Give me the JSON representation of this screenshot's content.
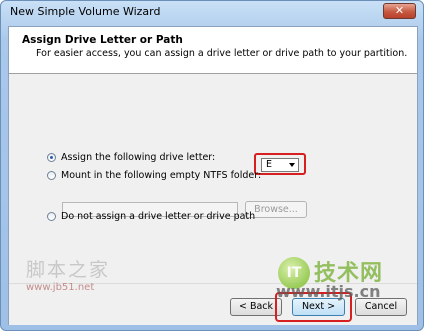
{
  "window": {
    "title": "New Simple Volume Wizard",
    "close_label": "✕"
  },
  "header": {
    "title": "Assign Drive Letter or Path",
    "subtitle": "For easier access, you can assign a drive letter or drive path to your partition."
  },
  "options": {
    "assign_letter": {
      "label": "Assign the following drive letter:",
      "selected": true
    },
    "mount_folder": {
      "label": "Mount in the following empty NTFS folder:",
      "selected": false
    },
    "no_assign": {
      "label": "Do not assign a drive letter or drive path",
      "selected": false
    }
  },
  "drive_letter": {
    "value": "E"
  },
  "folder_path": {
    "value": ""
  },
  "buttons": {
    "browse": "Browse...",
    "back": "< Back",
    "next": "Next >",
    "cancel": "Cancel"
  },
  "watermarks": {
    "cn_site": "脚本之家",
    "cn_url": "www.jb51.net",
    "logo_badge": "IT",
    "logo_text": "技术网",
    "logo_url": "www.itjs.cn"
  },
  "colors": {
    "highlight": "#d61f1f",
    "accent": "#2a5fb0"
  }
}
